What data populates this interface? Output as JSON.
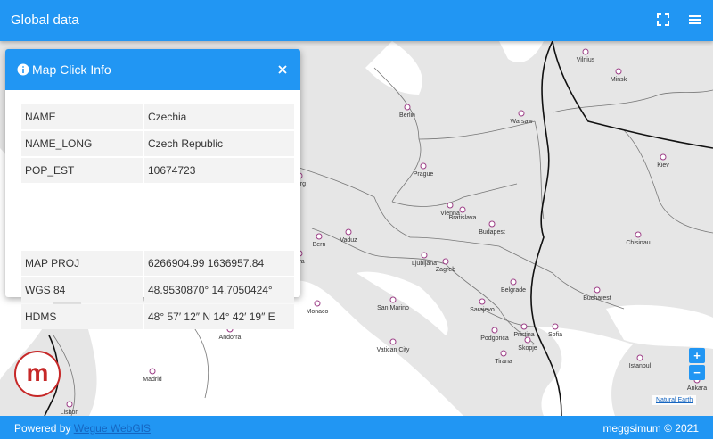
{
  "app_bar": {
    "title": "Global data",
    "fullscreen_icon": "fullscreen-icon",
    "menu_icon": "menu-icon"
  },
  "panel": {
    "title": "Map Click Info",
    "info_icon": "info-icon",
    "close_icon": "close-icon",
    "feature_rows": [
      {
        "key": "NAME",
        "value": "Czechia"
      },
      {
        "key": "NAME_LONG",
        "value": "Czech Republic"
      },
      {
        "key": "POP_EST",
        "value": "10674723"
      }
    ],
    "coord_rows": [
      {
        "key": "MAP PROJ",
        "value": "6266904.99 1636957.84"
      },
      {
        "key": "WGS 84",
        "value": "48.9530870° 14.7050424°"
      },
      {
        "key": "HDMS",
        "value": "48° 57′ 12″ N 14° 42′ 19″ E"
      }
    ]
  },
  "map": {
    "cities": [
      "Vilnius",
      "Minsk",
      "Berlin",
      "Warsaw",
      "Kiev",
      "Prague",
      "Vienna",
      "Bratislava",
      "Budapest",
      "Chisinau",
      "burg",
      "Bern",
      "Vaduz",
      "eva",
      "Ljubljana",
      "Zagreb",
      "Belgrade",
      "Bucharest",
      "Monaco",
      "San Marino",
      "Sarajevo",
      "Pristina",
      "Sofia",
      "Podgorica",
      "Skopje",
      "Andorra",
      "Vatican City",
      "Tirana",
      "Istanbul",
      "Ankara",
      "Madrid",
      "Lisbon"
    ],
    "colors": {
      "land": "#e6e6e6",
      "sea": "#ffffff",
      "border": "#777777",
      "city_ring": "#9c3d86"
    }
  },
  "zoom": {
    "in_label": "+",
    "out_label": "−"
  },
  "attribution": "Natural Earth",
  "logo_letter": "m",
  "footer": {
    "powered_by": "Powered by",
    "link": "Wegue WebGIS",
    "copyright": "meggsimum © 2021"
  }
}
